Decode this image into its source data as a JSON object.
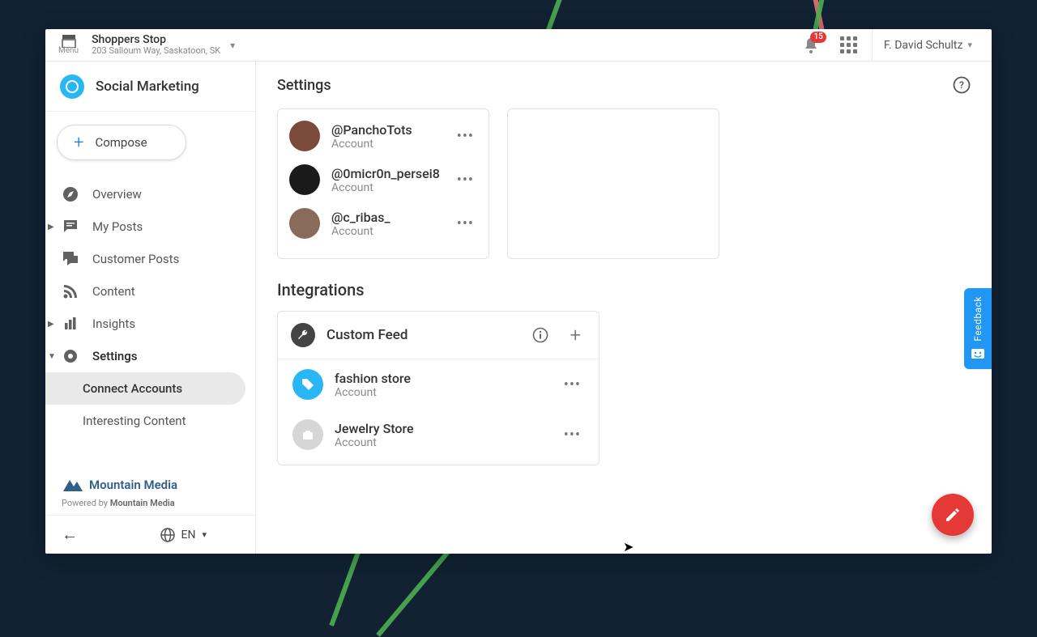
{
  "topbar": {
    "menu": "Menu",
    "loc_name": "Shoppers Stop",
    "loc_addr": "203 Salloum Way, Saskatoon, SK",
    "badge": "15",
    "user": "F. David Schultz"
  },
  "brand": {
    "name": "Social Marketing"
  },
  "compose": "Compose",
  "nav": {
    "overview": "Overview",
    "myposts": "My Posts",
    "customer": "Customer Posts",
    "content": "Content",
    "insights": "Insights",
    "settings": "Settings"
  },
  "sub": {
    "connect": "Connect Accounts",
    "interesting": "Interesting Content"
  },
  "footer": {
    "brand": "Mountain Media",
    "powered_pre": "Powered by ",
    "powered": "Mountain Media"
  },
  "lang": "EN",
  "page": {
    "title": "Settings"
  },
  "accounts": [
    {
      "name": "@PanchoTots",
      "type": "Account"
    },
    {
      "name": "@0micr0n_persei8",
      "type": "Account"
    },
    {
      "name": "@c_ribas_",
      "type": "Account"
    }
  ],
  "integrations": {
    "title": "Integrations",
    "feed": "Custom Feed",
    "items": [
      {
        "name": "fashion store",
        "type": "Account"
      },
      {
        "name": "Jewelry Store",
        "type": "Account"
      }
    ]
  },
  "feedback": "Feedback"
}
